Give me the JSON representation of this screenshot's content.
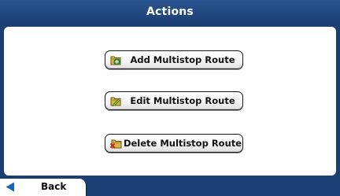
{
  "header": {
    "title": "Actions"
  },
  "actions": [
    {
      "label": "Add Multistop Route",
      "icon": "add-route-icon"
    },
    {
      "label": "Edit Multistop Route",
      "icon": "edit-route-icon"
    },
    {
      "label": "Delete Multistop Route",
      "icon": "delete-route-icon"
    }
  ],
  "footer": {
    "back_label": "Back",
    "back_icon": "back-arrow-icon"
  },
  "colors": {
    "header_bg": "#1b3f73",
    "panel_bg": "#ffffff",
    "back_arrow": "#1565c0"
  }
}
